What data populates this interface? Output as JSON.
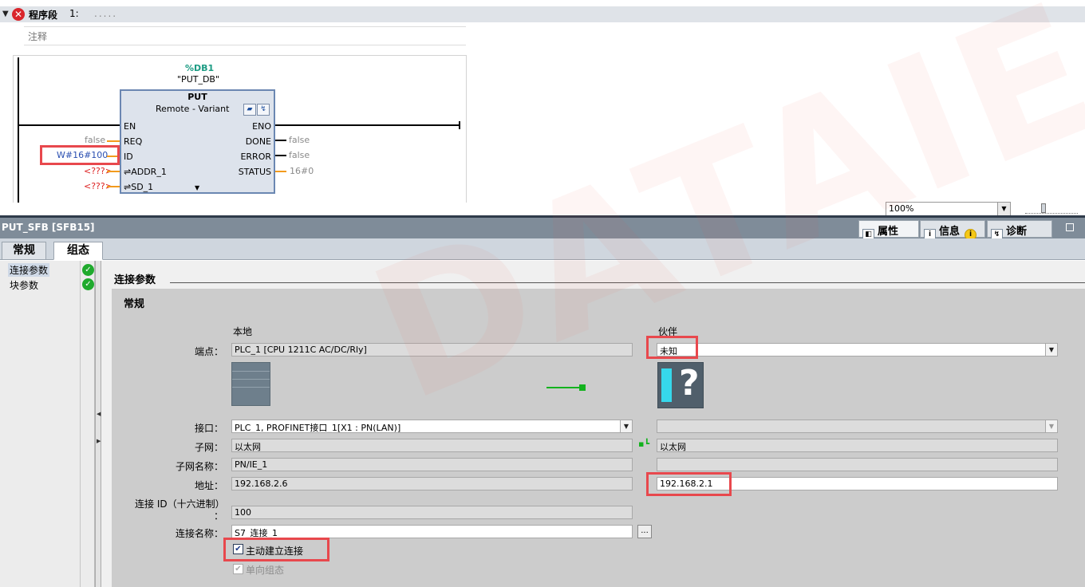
{
  "network": {
    "title": "程序段",
    "number": "1:",
    "placeholder_dots": ".....",
    "comment": "注释"
  },
  "block": {
    "db_name": "%DB1",
    "db_symbol": "\"PUT_DB\"",
    "type": "PUT",
    "variant": "Remote  -  Variant",
    "inputs": [
      "EN",
      "REQ",
      "ID",
      "⇌ADDR_1",
      "⇌SD_1"
    ],
    "outputs": [
      "ENO",
      "DONE",
      "ERROR",
      "STATUS"
    ],
    "req_value": "false",
    "id_value": "W#16#100",
    "addr_value": "<???>",
    "sd_value": "<???>",
    "done_value": "false",
    "error_value": "false",
    "status_value": "16#0"
  },
  "zoom": {
    "value": "100%"
  },
  "inspector": {
    "title": "PUT_SFB [SFB15]",
    "tab_properties": "属性",
    "tab_info": "信息",
    "tab_diagnostics": "诊断",
    "page_tabs": [
      "常规",
      "组态"
    ]
  },
  "nav": {
    "items": [
      {
        "label": "连接参数",
        "status": "ok"
      },
      {
        "label": "块参数",
        "status": "ok"
      }
    ]
  },
  "connection": {
    "section_title": "连接参数",
    "panel_title": "常规",
    "local_header": "本地",
    "partner_header": "伙伴",
    "labels": {
      "endpoint": "端点：",
      "interface": "接口：",
      "subnet": "子网：",
      "subnet_name": "子网名称：",
      "address": "地址：",
      "conn_id": "连接 ID（十六进制）",
      "conn_id_colon": "：",
      "conn_name": "连接名称："
    },
    "local": {
      "endpoint": "PLC_1 [CPU 1211C AC/DC/Rly]",
      "interface": "PLC_1, PROFINET接口_1[X1 : PN(LAN)]",
      "subnet": "以太网",
      "subnet_name": "PN/IE_1",
      "address": "192.168.2.6"
    },
    "partner": {
      "endpoint": "未知",
      "interface": "",
      "subnet": "以太网",
      "subnet_name": "",
      "address": "192.168.2.1"
    },
    "conn_id": "100",
    "conn_name": "S7_连接_1",
    "browse_label": "...",
    "active_conn": {
      "label": "主动建立连接",
      "checked": true
    },
    "one_way": {
      "label": "单向组态",
      "checked": true,
      "disabled": true
    }
  },
  "colors": {
    "highlight": "#e8484d",
    "link": "#13b21e",
    "header": "#7f8c99"
  }
}
